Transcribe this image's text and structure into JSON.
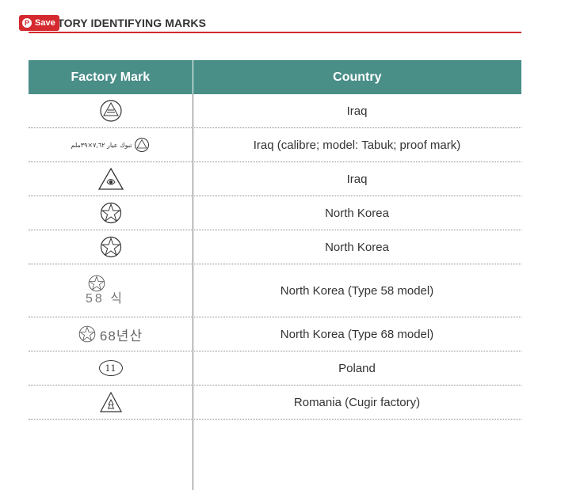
{
  "save_button": {
    "label": "Save",
    "icon": "pinterest-icon"
  },
  "heading": "CTORY IDENTIFYING MARKS",
  "table": {
    "headers": {
      "mark": "Factory Mark",
      "country": "Country"
    },
    "rows": [
      {
        "country": "Iraq",
        "mark_icon": "iraq-factory-mark-icon"
      },
      {
        "country": "Iraq (calibre; model: Tabuk; proof mark)",
        "mark_icon": "iraq-tabuk-proof-mark-icon",
        "mark_text": "تبوك عيار ٧,٦٢×٣٩ملم"
      },
      {
        "country": "Iraq",
        "mark_icon": "iraq-triangle-mark-icon"
      },
      {
        "country": "North Korea",
        "mark_icon": "north-korea-star-mark-icon"
      },
      {
        "country": "North Korea",
        "mark_icon": "north-korea-star-mark-icon"
      },
      {
        "country": "North Korea (Type 58 model)",
        "mark_icon": "north-korea-type58-mark-icon",
        "mark_text": "58 식"
      },
      {
        "country": "North Korea (Type 68 model)",
        "mark_icon": "north-korea-type68-mark-icon",
        "mark_text": "68년산"
      },
      {
        "country": "Poland",
        "mark_icon": "poland-oval-11-mark-icon",
        "mark_text": "11"
      },
      {
        "country": "Romania (Cugir factory)",
        "mark_icon": "romania-cugir-mark-icon"
      }
    ]
  }
}
